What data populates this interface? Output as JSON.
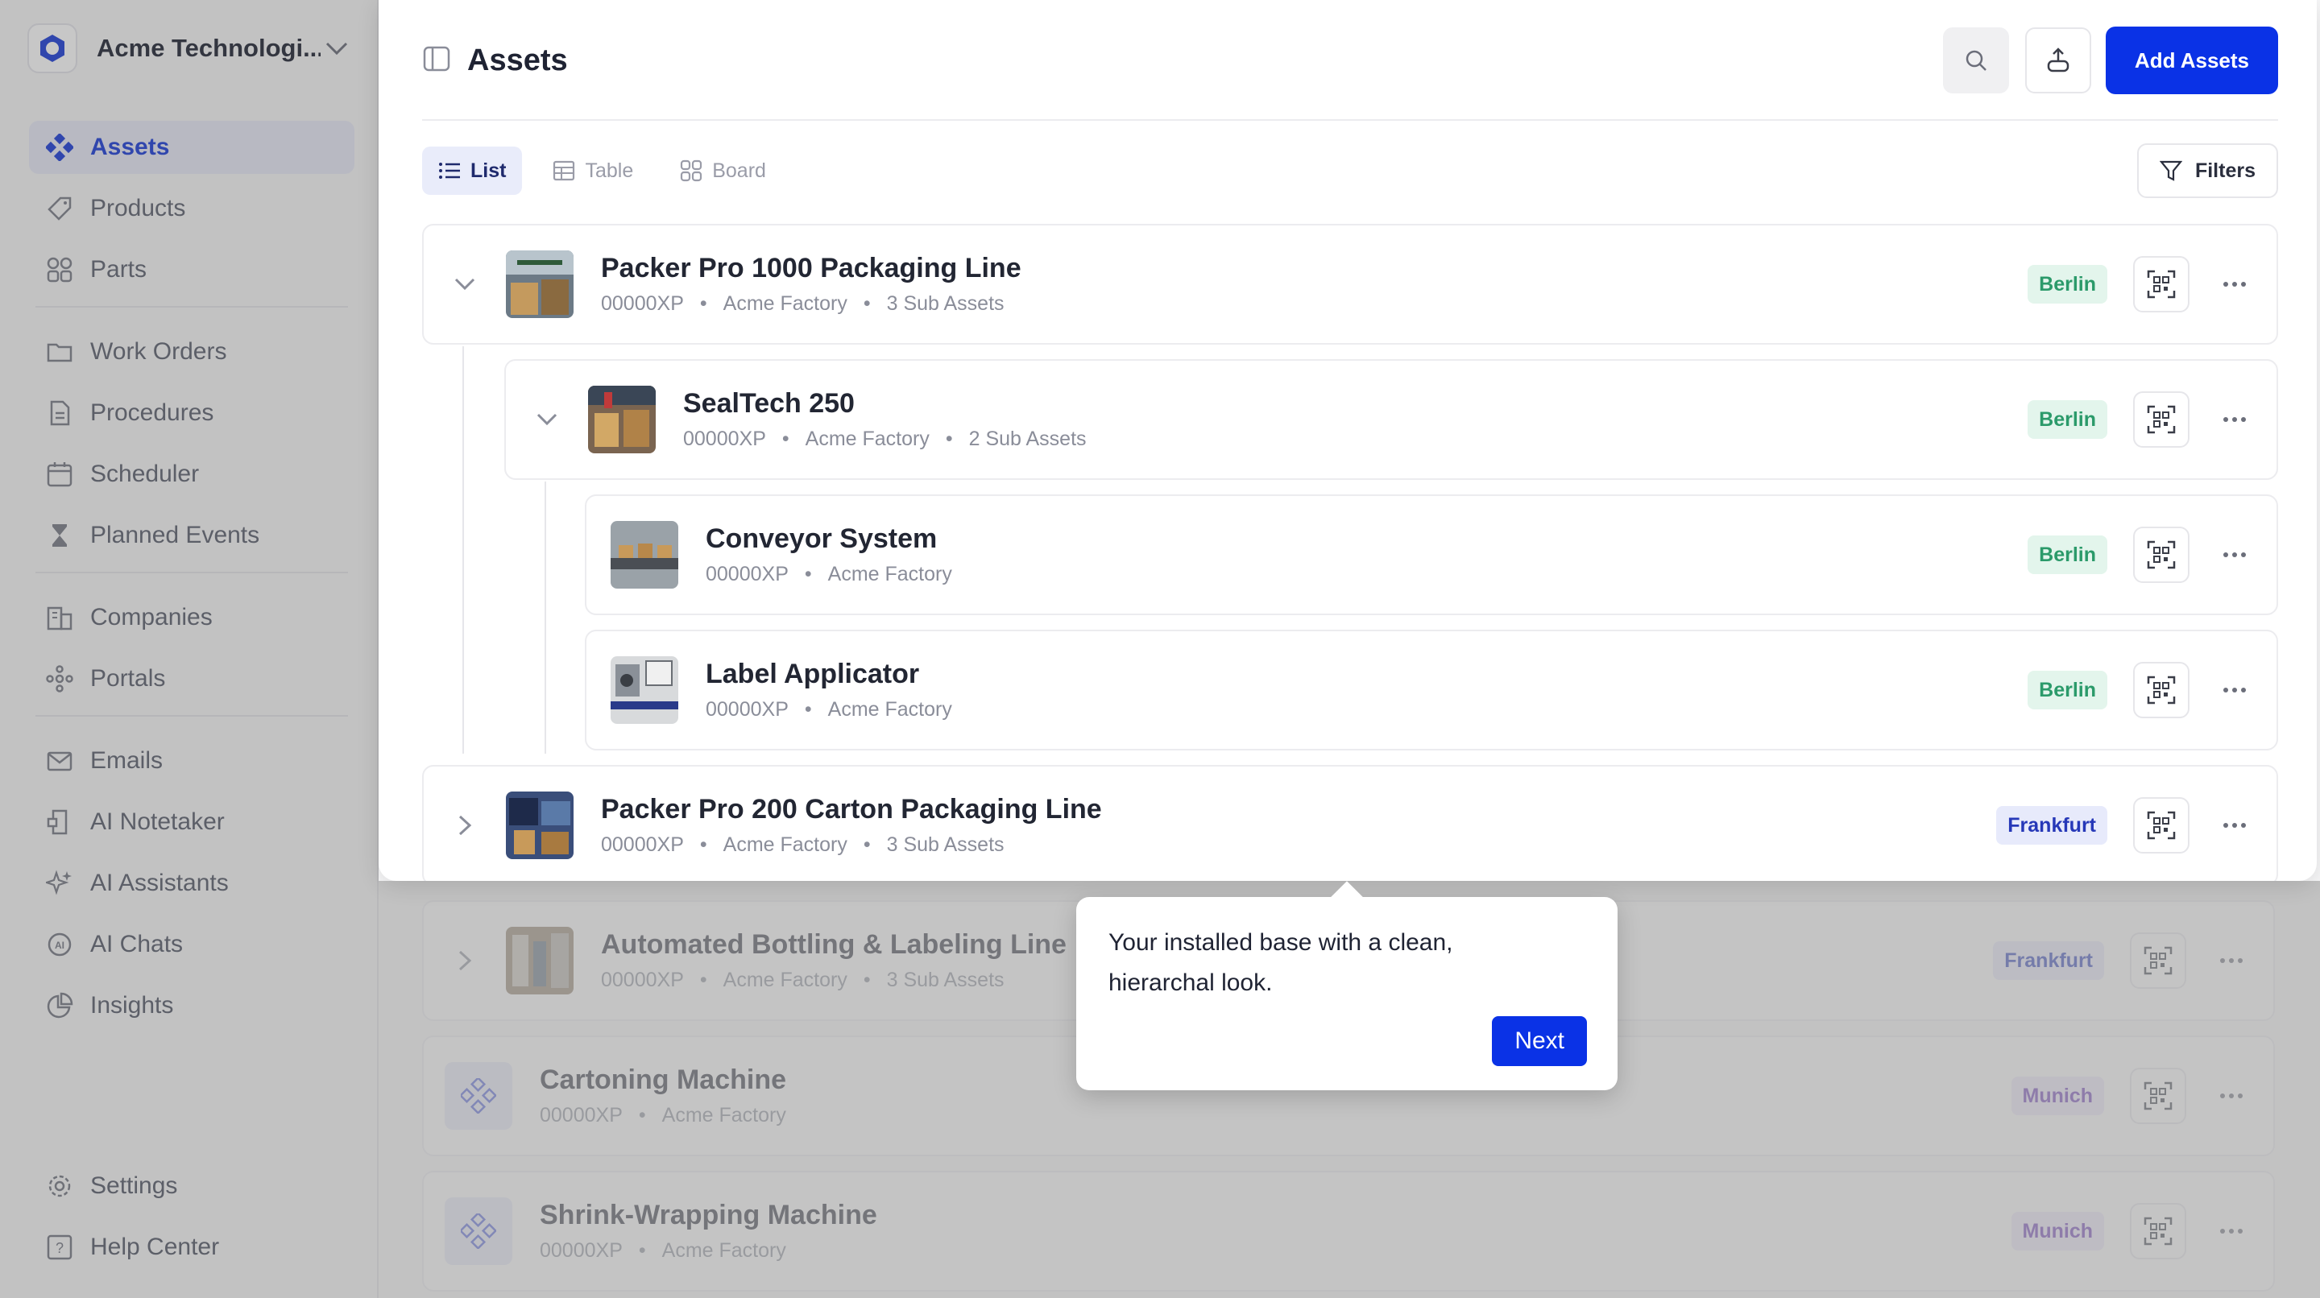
{
  "org": {
    "name": "Acme Technologi..."
  },
  "sidebar": {
    "items": [
      {
        "label": "Assets",
        "icon": "assets-icon",
        "active": true
      },
      {
        "label": "Products",
        "icon": "tag-icon"
      },
      {
        "label": "Parts",
        "icon": "grid-icon"
      },
      {
        "label": "Work Orders",
        "icon": "folder-icon"
      },
      {
        "label": "Procedures",
        "icon": "document-icon"
      },
      {
        "label": "Scheduler",
        "icon": "calendar-icon"
      },
      {
        "label": "Planned Events",
        "icon": "hourglass-icon"
      },
      {
        "label": "Companies",
        "icon": "building-icon"
      },
      {
        "label": "Portals",
        "icon": "portal-icon"
      },
      {
        "label": "Emails",
        "icon": "mail-icon"
      },
      {
        "label": "AI Notetaker",
        "icon": "notetaker-icon"
      },
      {
        "label": "AI Assistants",
        "icon": "sparkle-icon"
      },
      {
        "label": "AI Chats",
        "icon": "chat-icon"
      },
      {
        "label": "Insights",
        "icon": "pie-chart-icon"
      }
    ],
    "bottom": [
      {
        "label": "Settings",
        "icon": "gear-icon"
      },
      {
        "label": "Help Center",
        "icon": "help-icon"
      }
    ]
  },
  "header": {
    "title": "Assets",
    "add_label": "Add Assets"
  },
  "views": {
    "list": "List",
    "table": "Table",
    "board": "Board",
    "filters": "Filters"
  },
  "assets": [
    {
      "name": "Packer Pro 1000 Packaging Line",
      "code": "00000XP",
      "site": "Acme Factory",
      "sub": "3 Sub Assets",
      "location": "Berlin"
    },
    {
      "name": "SealTech 250",
      "code": "00000XP",
      "site": "Acme Factory",
      "sub": "2 Sub Assets",
      "location": "Berlin"
    },
    {
      "name": "Conveyor System",
      "code": "00000XP",
      "site": "Acme Factory",
      "location": "Berlin"
    },
    {
      "name": "Label Applicator",
      "code": "00000XP",
      "site": "Acme Factory",
      "location": "Berlin"
    },
    {
      "name": "Packer Pro 200 Carton Packaging Line",
      "code": "00000XP",
      "site": "Acme Factory",
      "sub": "3 Sub Assets",
      "location": "Frankfurt"
    },
    {
      "name": "Automated Bottling & Labeling Line",
      "code": "00000XP",
      "site": "Acme Factory",
      "sub": "3 Sub Assets",
      "location": "Frankfurt"
    },
    {
      "name": "Cartoning Machine",
      "code": "00000XP",
      "site": "Acme Factory",
      "location": "Munich"
    },
    {
      "name": "Shrink-Wrapping Machine",
      "code": "00000XP",
      "site": "Acme Factory",
      "location": "Munich"
    }
  ],
  "tooltip": {
    "text": "Your installed base with a clean, hierarchal look.",
    "next": "Next"
  },
  "colors": {
    "accent": "#0a32e6",
    "berlin": "#2b9a6a",
    "frankfurt": "#2638b8",
    "munich": "#6a3ab8"
  }
}
